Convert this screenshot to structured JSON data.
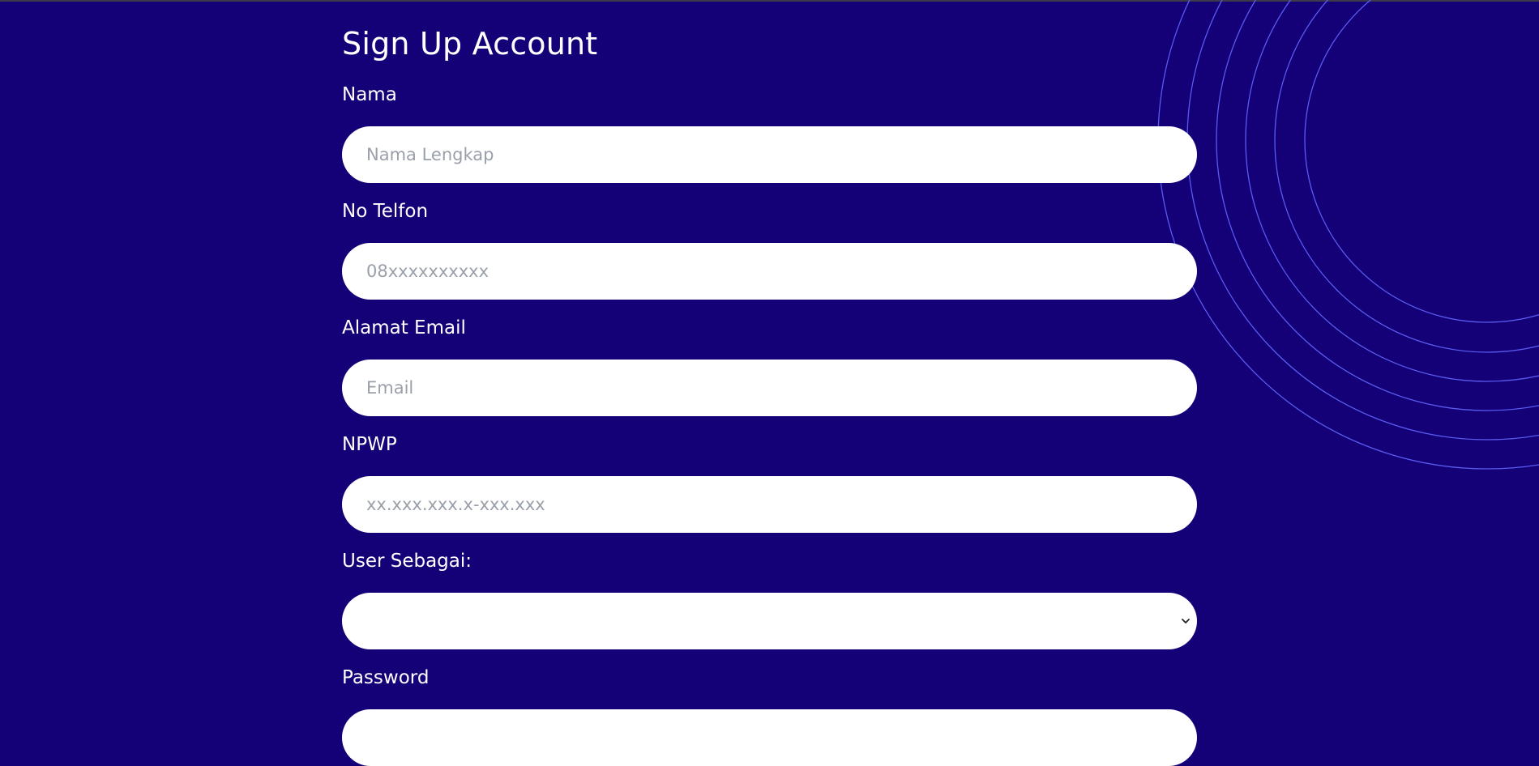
{
  "form": {
    "title": "Sign Up Account",
    "fields": [
      {
        "label": "Nama",
        "placeholder": "Nama Lengkap",
        "value": ""
      },
      {
        "label": "No Telfon",
        "placeholder": "08xxxxxxxxxx",
        "value": ""
      },
      {
        "label": "Alamat Email",
        "placeholder": "Email",
        "value": ""
      },
      {
        "label": "NPWP",
        "placeholder": "xx.xxx.xxx.x-xxx.xxx",
        "value": ""
      }
    ],
    "role": {
      "label": "User Sebagai:",
      "selected": ""
    },
    "password": {
      "label": "Password"
    }
  },
  "colors": {
    "background": "#140077",
    "field": "#ffffff",
    "decoration_rings": "#5a5cf0"
  },
  "icons": {
    "select_arrow": "chevron-down-icon"
  }
}
